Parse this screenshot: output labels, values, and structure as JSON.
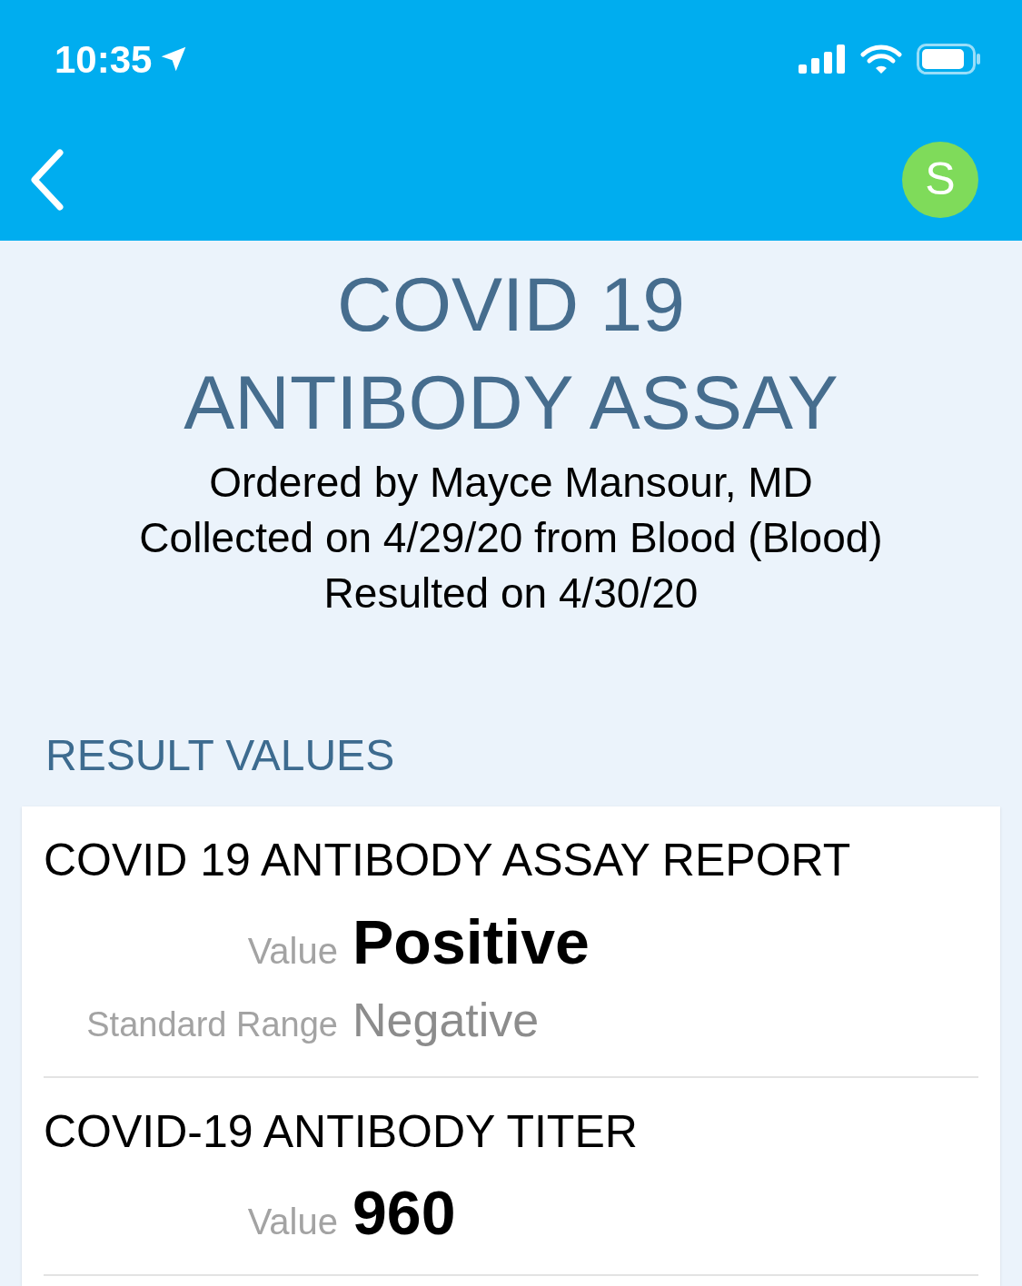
{
  "status_bar": {
    "time": "10:35"
  },
  "nav": {
    "avatar": "S"
  },
  "header": {
    "title": "COVID 19 ANTIBODY ASSAY",
    "details": [
      "Ordered by Mayce Mansour, MD",
      "Collected on 4/29/20 from Blood (Blood)",
      "Resulted on 4/30/20"
    ]
  },
  "section_title": "RESULT VALUES",
  "results": [
    {
      "name": "COVID 19 ANTIBODY ASSAY REPORT",
      "fields": [
        {
          "kind": "value",
          "label": "Value",
          "value": "Positive"
        },
        {
          "kind": "range",
          "label": "Standard Range",
          "value": "Negative"
        }
      ]
    },
    {
      "name": "COVID-19 ANTIBODY TITER",
      "fields": [
        {
          "kind": "value",
          "label": "Value",
          "value": "960"
        }
      ]
    }
  ]
}
